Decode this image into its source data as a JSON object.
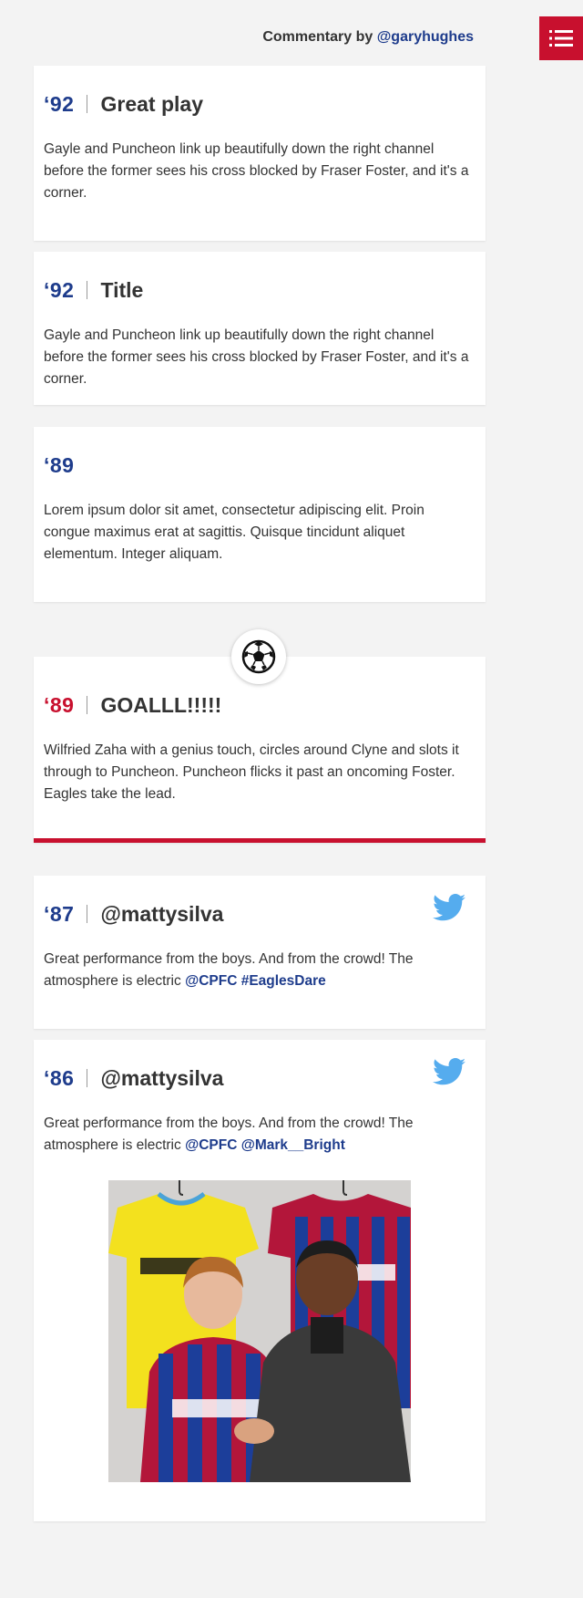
{
  "header": {
    "byline_prefix": "Commentary by",
    "byline_handle": "@garyhughes",
    "menu_icon": "list-menu-icon"
  },
  "colors": {
    "accent_red": "#c8102e",
    "team_blue": "#1e3c8c",
    "twitter_blue": "#55acee",
    "background": "#f3f3f3"
  },
  "entries": [
    {
      "minute": "‘92",
      "title": "Great play",
      "text": "Gayle and Puncheon link up beautifully down the right channel before the former sees his cross blocked by Fraser Foster, and it's a corner."
    },
    {
      "minute": "‘92",
      "title": "Title",
      "text": "Gayle and Puncheon link up beautifully down the right channel before the former sees his cross blocked by Fraser Foster, and it's a corner."
    },
    {
      "minute": "‘89",
      "text": "Lorem ipsum dolor sit amet, consectetur adipiscing elit. Proin congue maximus erat at sagittis. Quisque tincidunt aliquet elementum. Integer aliquam."
    },
    {
      "minute": "‘89",
      "title": "GOALLL!!!!!",
      "text": "Wilfried Zaha with a genius touch, circles around Clyne and slots it through to Puncheon. Puncheon flicks it past an oncoming Foster. Eagles take the lead.",
      "icon": "football-icon"
    },
    {
      "minute": "‘87",
      "title": "@mattysilva",
      "text": "Great performance from the boys. And from the crowd! The atmosphere is electric",
      "links": [
        "@CPFC",
        "#EaglesDare"
      ],
      "icon": "twitter-bird-icon"
    },
    {
      "minute": "‘86",
      "title": "@mattysilva",
      "text": "Great performance from the boys. And from the crowd! The atmosphere is electric",
      "links": [
        "@CPFC",
        "@Mark__Bright"
      ],
      "icon": "twitter-bird-icon"
    }
  ]
}
